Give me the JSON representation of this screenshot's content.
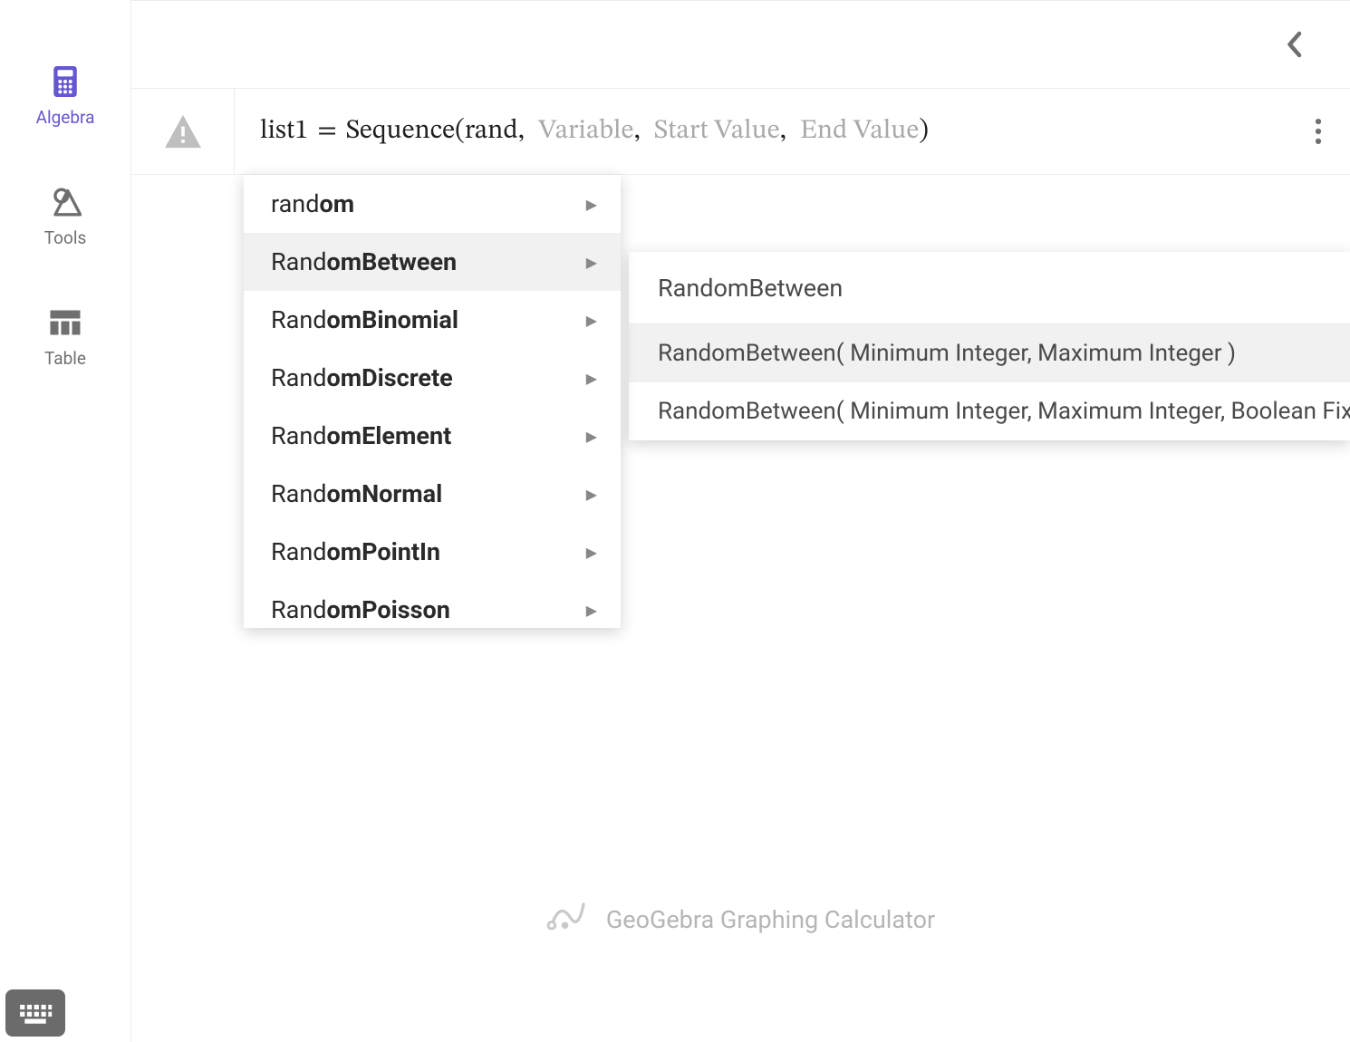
{
  "sidebar": {
    "items": [
      {
        "label": "Algebra",
        "icon": "calculator-icon",
        "active": true
      },
      {
        "label": "Tools",
        "icon": "tools-icon",
        "active": false
      },
      {
        "label": "Table",
        "icon": "table-icon",
        "active": false
      }
    ]
  },
  "topbar": {
    "collapse_icon": "chevron-left-icon"
  },
  "input_row": {
    "marker_icon": "warning-icon",
    "expression": {
      "lhs": "list1",
      "eq": "=",
      "fn": "Sequence",
      "args": [
        {
          "text": "rand",
          "placeholder": false
        },
        {
          "text": "Variable",
          "placeholder": true
        },
        {
          "text": "Start Value",
          "placeholder": true
        },
        {
          "text": "End Value",
          "placeholder": true
        }
      ]
    },
    "more_icon": "more-vert-icon"
  },
  "autocomplete": {
    "query_prefix": "rand",
    "items": [
      {
        "prefix": "rand",
        "bold": "om",
        "selected": false
      },
      {
        "prefix": "Rand",
        "bold": "omBetween",
        "selected": true
      },
      {
        "prefix": "Rand",
        "bold": "omBinomial",
        "selected": false
      },
      {
        "prefix": "Rand",
        "bold": "omDiscrete",
        "selected": false
      },
      {
        "prefix": "Rand",
        "bold": "omElement",
        "selected": false
      },
      {
        "prefix": "Rand",
        "bold": "omNormal",
        "selected": false
      },
      {
        "prefix": "Rand",
        "bold": "omPointIn",
        "selected": false
      },
      {
        "prefix": "Rand",
        "bold": "omPoisson",
        "selected": false
      }
    ]
  },
  "syntax_panel": {
    "title": "RandomBetween",
    "variants": [
      {
        "text": "RandomBetween( Minimum Integer, Maximum Integer )",
        "selected": true
      },
      {
        "text": "RandomBetween( Minimum Integer, Maximum Integer, Boolean Fixed )",
        "selected": false
      }
    ]
  },
  "branding": {
    "logo_icon": "geogebra-logo-icon",
    "text": "GeoGebra Graphing Calculator"
  },
  "keyboard_button_icon": "keyboard-icon"
}
